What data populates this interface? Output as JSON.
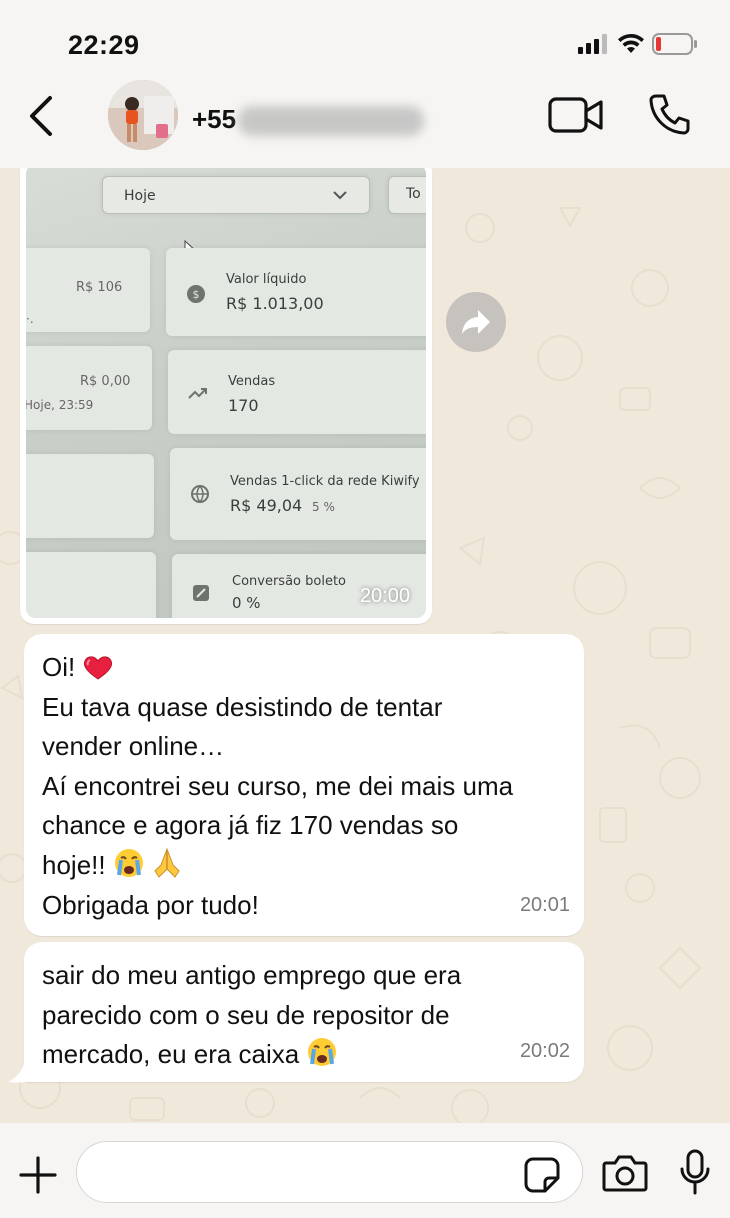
{
  "status_bar": {
    "time": "22:29"
  },
  "header": {
    "contact_prefix": "+55",
    "video_icon": "video-camera-icon",
    "call_icon": "phone-icon",
    "back_icon": "chevron-left-icon"
  },
  "photo": {
    "dropdown_label": "Hoje",
    "dropdown_next": "To",
    "left_col": {
      "val1": "R$ 106",
      "val2": "R$ 0,00",
      "val2_sub": "Hoje, 23:59"
    },
    "cards": [
      {
        "label": "Valor líquido",
        "value": "R$ 1.013,00",
        "extra": ""
      },
      {
        "label": "Vendas",
        "value": "170",
        "extra": ""
      },
      {
        "label": "Vendas 1-click da rede Kiwify",
        "value": "R$ 49,04",
        "extra": "5 %"
      },
      {
        "label": "Conversão boleto",
        "value": "0 %",
        "extra": ""
      }
    ],
    "time": "20:00"
  },
  "messages": [
    {
      "lines": [
        "Oi!",
        "Eu tava quase desistindo de tentar",
        "vender online…",
        "Aí encontrei seu curso, me dei mais uma",
        "chance e agora já fiz 170 vendas so",
        "hoje!!",
        "Obrigada por tudo!"
      ],
      "time": "20:01"
    },
    {
      "lines": [
        "sair do meu antigo emprego que era",
        "parecido com o seu de repositor de",
        "mercado, eu era caixa"
      ],
      "time": "20:02"
    }
  ],
  "composer": {
    "placeholder": ""
  },
  "colors": {
    "chat_bg": "#f1e8dc",
    "bubble": "#ffffff",
    "bar_bg": "#f6f5f3",
    "battery_low": "#e53935"
  }
}
